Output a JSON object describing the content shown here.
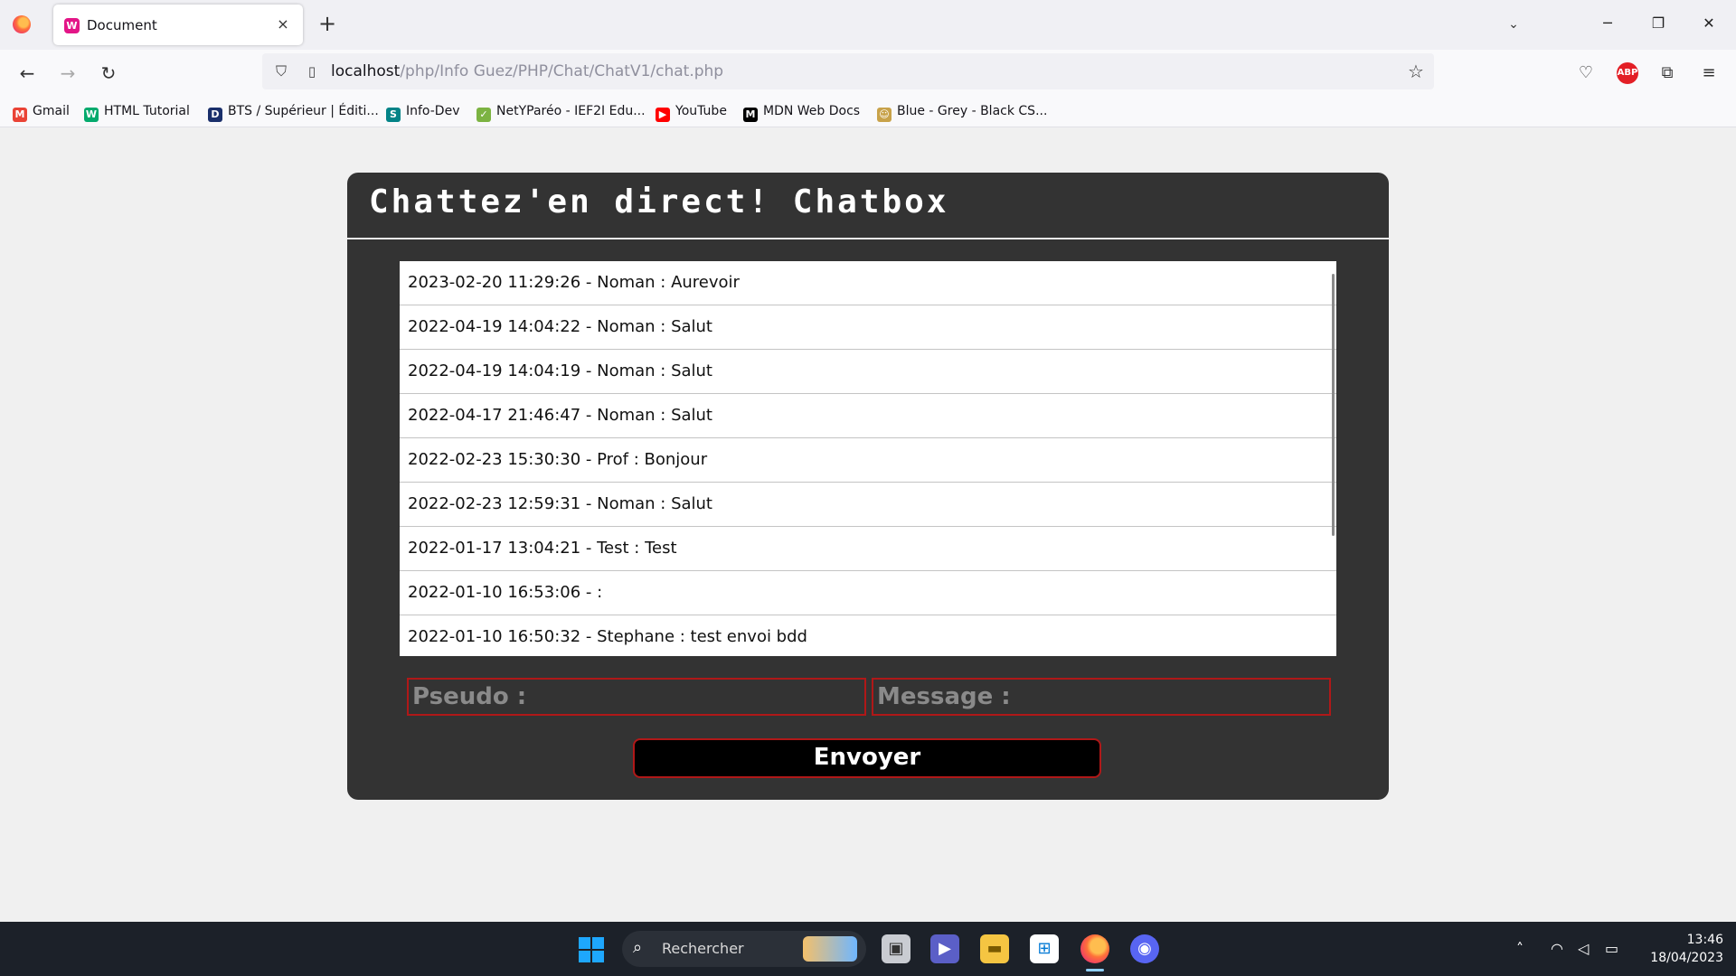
{
  "browser": {
    "tab_title": "Document",
    "tab_close": "×",
    "new_tab": "+",
    "url_host": "localhost",
    "url_path": "/php/Info Guez/PHP/Chat/ChatV1/chat.php",
    "bookmarks": [
      {
        "label": "Gmail",
        "icon": "gmail-icon",
        "color": "#ea4335",
        "glyph": "M"
      },
      {
        "label": "HTML Tutorial",
        "icon": "w3schools-icon",
        "color": "#04aa6d",
        "glyph": "W"
      },
      {
        "label": "BTS / Supérieur | Éditi...",
        "icon": "d-logo-icon",
        "color": "#1a2f6b",
        "glyph": "D"
      },
      {
        "label": "Info-Dev",
        "icon": "sharepoint-icon",
        "color": "#038387",
        "glyph": "S"
      },
      {
        "label": "NetYParéo - IEF2I Edu...",
        "icon": "netypareo-icon",
        "color": "#7cb342",
        "glyph": "✓"
      },
      {
        "label": "YouTube",
        "icon": "youtube-icon",
        "color": "#ff0000",
        "glyph": "▶"
      },
      {
        "label": "MDN Web Docs",
        "icon": "mdn-icon",
        "color": "#000000",
        "glyph": "M"
      },
      {
        "label": "Blue - Grey - Black CS...",
        "icon": "avatar-bookmark-icon",
        "color": "#c8a24a",
        "glyph": "☺"
      }
    ],
    "abp_label": "ABP"
  },
  "chat": {
    "title": "Chattez'en direct! Chatbox",
    "messages": [
      "2023-02-20 11:29:26 - Noman : Aurevoir",
      "2022-04-19 14:04:22 - Noman : Salut",
      "2022-04-19 14:04:19 - Noman : Salut",
      "2022-04-17 21:46:47 - Noman : Salut",
      "2022-02-23 15:30:30 - Prof : Bonjour",
      "2022-02-23 12:59:31 - Noman : Salut",
      "2022-01-17 13:04:21 - Test : Test",
      "2022-01-10 16:53:06 - :",
      "2022-01-10 16:50:32 - Stephane : test envoi bdd"
    ],
    "pseudo_placeholder": "Pseudo :",
    "message_placeholder": "Message :",
    "send_label": "Envoyer",
    "colors": {
      "panel": "#333333",
      "border_accent": "#b01818"
    }
  },
  "taskbar": {
    "search_label": "Rechercher",
    "time": "13:46",
    "date": "18/04/2023"
  }
}
